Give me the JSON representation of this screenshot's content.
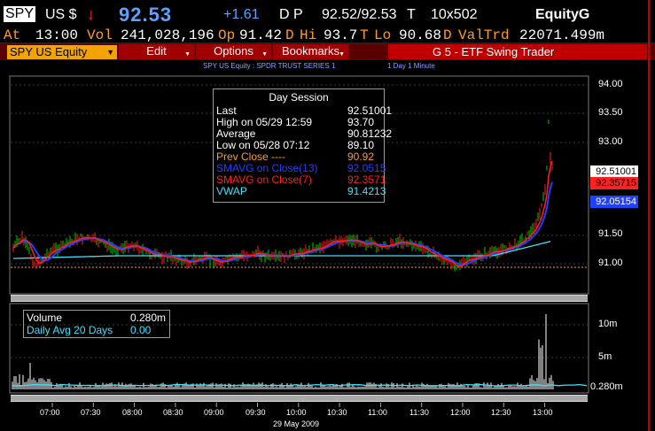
{
  "header": {
    "ticker": "SPY",
    "market": "US $",
    "tick_arrow": "↓",
    "last_price": "92.53",
    "net_change": "+1.61",
    "dp_label": "D P",
    "bid_ask": "92.52/92.53",
    "t_label": "T",
    "size": "10x502",
    "yellow_key": "EquityG"
  },
  "quote_line": {
    "at_label": "At",
    "time": "13:00",
    "vol_label": "Vol",
    "volume": "241,028,196",
    "op_label": "Op",
    "open": "91.42",
    "d1": "D",
    "hi_label": "Hi",
    "high": "93.7",
    "t1": "T",
    "lo_label": "Lo",
    "low": "90.68",
    "d2": "D",
    "valtrd_label": "ValTrd",
    "value_traded": "22071.499m"
  },
  "toolbar": {
    "security": "SPY US Equity",
    "edit": "Edit",
    "options": "Options",
    "bookmarks": "Bookmarks",
    "title": "G 5 - ETF Swing Trader"
  },
  "info": {
    "security_name": "SPY US Equity : SPDR TRUST SERIES 1",
    "period": "1 Day  1 Minute"
  },
  "day_session": {
    "title": "Day Session",
    "rows": [
      {
        "label": "Last",
        "value": "92.51001",
        "color": "#ffffff"
      },
      {
        "label": "High on  05/29 12:59",
        "value": "93.70",
        "color": "#ffffff"
      },
      {
        "label": "Average",
        "value": "90.81232",
        "color": "#ffffff"
      },
      {
        "label": "Low on  05/28 07:12",
        "value": "89.10",
        "color": "#ffffff"
      },
      {
        "label": "Prev Close ----",
        "value": "90.92",
        "color": "#ff9a20"
      },
      {
        "label": "SMAVG on Close(13)",
        "value": "92.0515",
        "color": "#2040ff"
      },
      {
        "label": "SMAVG on Close(7)",
        "value": "92.3571",
        "color": "#ff2020"
      },
      {
        "label": "VWAP",
        "value": "91.4213",
        "color": "#40e0ff"
      }
    ]
  },
  "volume_panel": {
    "label": "Volume",
    "value": "0.280m",
    "avg_label": "Daily Avg 20 Days",
    "avg_value": "0.00"
  },
  "price_tags": {
    "last": "92.51001",
    "sma7": "92.35715",
    "sma13": "92.05154"
  },
  "price_axis": [
    "94.00",
    "93.50",
    "93.00",
    "91.50",
    "91.00"
  ],
  "volume_axis": [
    "10m",
    "5m",
    "0.280m"
  ],
  "time_axis": [
    "07:00",
    "07:30",
    "08:00",
    "08:30",
    "09:00",
    "09:30",
    "10:00",
    "10:30",
    "11:00",
    "11:30",
    "12:00",
    "12:30",
    "13:00"
  ],
  "date": "29 May 2009",
  "colors": {
    "orange": "#ff9a20",
    "blue_price": "#5fa0ff",
    "red": "#ff2020",
    "sma13": "#2040ff",
    "vwap": "#40e0ff",
    "menu_red": "#a00000"
  }
}
